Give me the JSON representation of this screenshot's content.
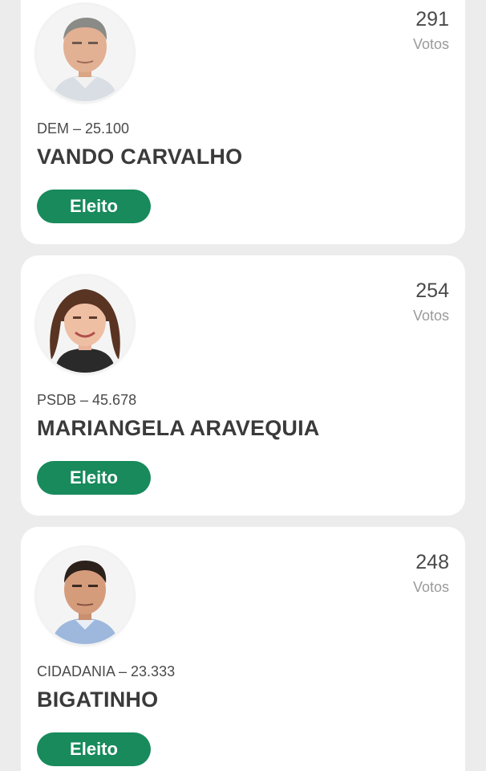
{
  "colors": {
    "badge_green": "#188a5c",
    "card_bg": "#ffffff",
    "page_bg": "#ececec"
  },
  "candidates": [
    {
      "votes": "291",
      "votes_label": "Votos",
      "party_number": "DEM – 25.100",
      "name": "VANDO CARVALHO",
      "status": "Eleito"
    },
    {
      "votes": "254",
      "votes_label": "Votos",
      "party_number": "PSDB – 45.678",
      "name": "MARIANGELA ARAVEQUIA",
      "status": "Eleito"
    },
    {
      "votes": "248",
      "votes_label": "Votos",
      "party_number": "CIDADANIA – 23.333",
      "name": "BIGATINHO",
      "status": "Eleito"
    }
  ]
}
